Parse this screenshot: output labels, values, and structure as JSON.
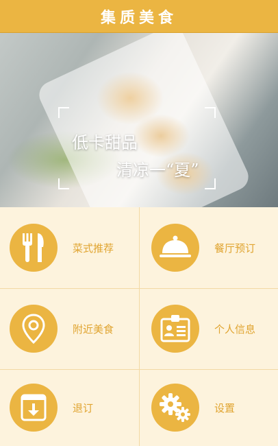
{
  "header": {
    "title": "集质美食"
  },
  "banner": {
    "line1": "低卡甜品",
    "line2": "清凉一“夏”"
  },
  "menu": {
    "items": [
      {
        "label": "菜式推荐",
        "icon": "fork-knife-icon"
      },
      {
        "label": "餐厅预订",
        "icon": "cloche-icon"
      },
      {
        "label": "附近美食",
        "icon": "location-pin-icon"
      },
      {
        "label": "个人信息",
        "icon": "id-card-icon"
      },
      {
        "label": "退订",
        "icon": "download-box-icon"
      },
      {
        "label": "设置",
        "icon": "gear-icon"
      }
    ]
  },
  "colors": {
    "accent": "#ebb542",
    "background": "#fdf3dd",
    "label": "#e0a430"
  }
}
